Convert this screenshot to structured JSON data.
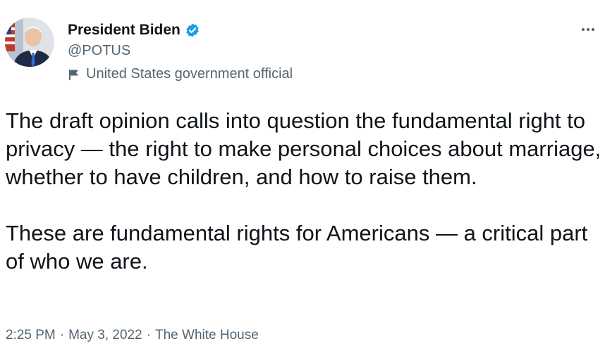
{
  "author": {
    "display_name": "President Biden",
    "handle": "@POTUS",
    "label": "United States government official",
    "avatar_icon": "portrait-avatar",
    "verified_icon": "verified-badge-icon",
    "label_icon": "flag-icon"
  },
  "more_icon": "more-options-icon",
  "tweet": {
    "paragraphs": [
      "The draft opinion calls into question the fundamental right to privacy — the right to make personal choices about marriage, whether to have children, and how to raise them.",
      "These are fundamental rights for Americans — a critical part of who we are."
    ]
  },
  "meta": {
    "time": "2:25 PM",
    "sep1": "·",
    "date": "May 3, 2022",
    "sep2": "·",
    "source": "The White House"
  },
  "colors": {
    "text": "#0f1419",
    "secondary": "#536471",
    "verified": "#1d9bf0"
  }
}
